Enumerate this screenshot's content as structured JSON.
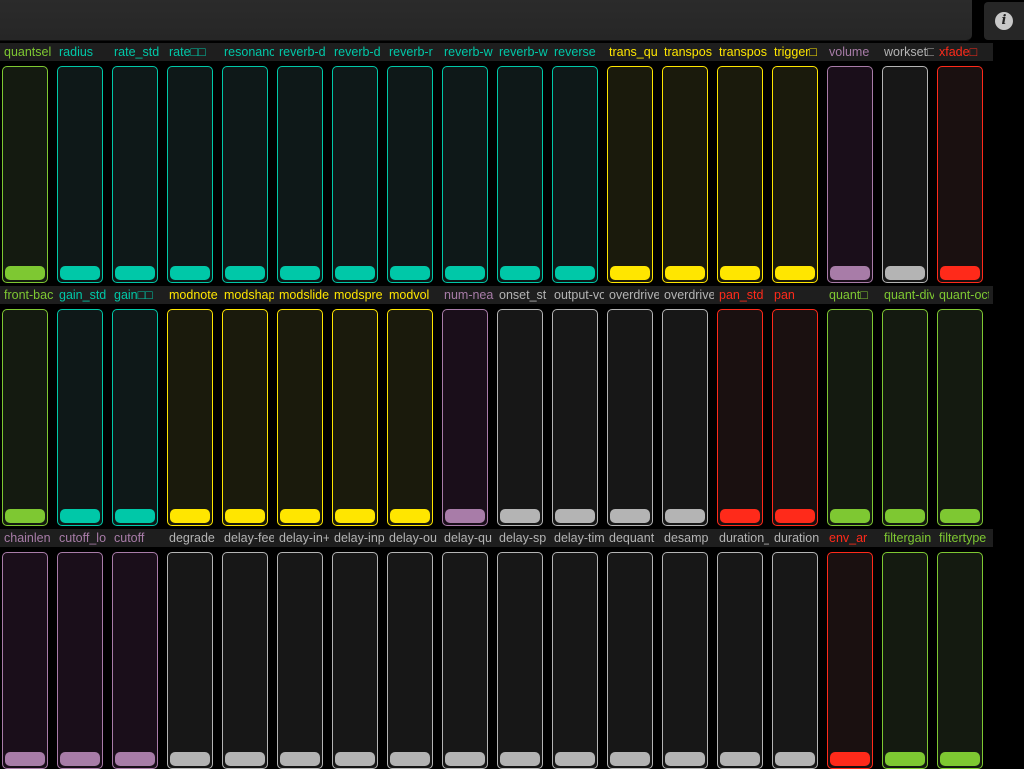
{
  "colors": {
    "green": "#7ec832",
    "teal": "#00c8a8",
    "yellow": "#ffe600",
    "purple": "#a87ca8",
    "gray": "#b4b4b4",
    "red": "#ff2a1a"
  },
  "info_icon": "info-icon",
  "rows": [
    {
      "sliders": [
        {
          "label": "quantsel",
          "color": "green",
          "value": 0
        },
        {
          "label": "radius",
          "color": "teal",
          "value": 0
        },
        {
          "label": "rate_std",
          "color": "teal",
          "value": 0
        },
        {
          "label": "rate□□",
          "color": "teal",
          "value": 0
        },
        {
          "label": "resonance",
          "color": "teal",
          "value": 0
        },
        {
          "label": "reverb-d",
          "color": "teal",
          "value": 0
        },
        {
          "label": "reverb-d",
          "color": "teal",
          "value": 0
        },
        {
          "label": "reverb-r",
          "color": "teal",
          "value": 0
        },
        {
          "label": "reverb-w",
          "color": "teal",
          "value": 0
        },
        {
          "label": "reverb-w",
          "color": "teal",
          "value": 0
        },
        {
          "label": "reverse",
          "color": "teal",
          "value": 0
        },
        {
          "label": "trans_qu",
          "color": "yellow",
          "value": 0
        },
        {
          "label": "transpos",
          "color": "yellow",
          "value": 0
        },
        {
          "label": "transpos",
          "color": "yellow",
          "value": 0
        },
        {
          "label": "trigger□",
          "color": "yellow",
          "value": 0
        },
        {
          "label": "volume",
          "color": "purple",
          "value": 0
        },
        {
          "label": "workset□",
          "color": "gray",
          "value": 0
        },
        {
          "label": "xfade□",
          "color": "red",
          "value": 0
        }
      ]
    },
    {
      "sliders": [
        {
          "label": "front-bac",
          "color": "green",
          "value": 0
        },
        {
          "label": "gain_std",
          "color": "teal",
          "value": 0
        },
        {
          "label": "gain□□",
          "color": "teal",
          "value": 0
        },
        {
          "label": "modnote",
          "color": "yellow",
          "value": 0
        },
        {
          "label": "modshap",
          "color": "yellow",
          "value": 0
        },
        {
          "label": "modslide",
          "color": "yellow",
          "value": 0
        },
        {
          "label": "modspre",
          "color": "yellow",
          "value": 0
        },
        {
          "label": "modvol",
          "color": "yellow",
          "value": 0
        },
        {
          "label": "num-nea",
          "color": "purple",
          "value": 0
        },
        {
          "label": "onset_st",
          "color": "gray",
          "value": 0
        },
        {
          "label": "output-vo",
          "color": "gray",
          "value": 0
        },
        {
          "label": "overdrive",
          "color": "gray",
          "value": 0
        },
        {
          "label": "overdrive",
          "color": "gray",
          "value": 0
        },
        {
          "label": "pan_std",
          "color": "red",
          "value": 0
        },
        {
          "label": "pan",
          "color": "red",
          "value": 0
        },
        {
          "label": "quant□",
          "color": "green",
          "value": 0
        },
        {
          "label": "quant-div",
          "color": "green",
          "value": 0
        },
        {
          "label": "quant-oct",
          "color": "green",
          "value": 0
        }
      ]
    },
    {
      "sliders": [
        {
          "label": "chainlen",
          "color": "purple",
          "value": 0
        },
        {
          "label": "cutoff_lo",
          "color": "purple",
          "value": 0
        },
        {
          "label": "cutoff",
          "color": "purple",
          "value": 0
        },
        {
          "label": "degrade",
          "color": "gray",
          "value": 0
        },
        {
          "label": "delay-fee",
          "color": "gray",
          "value": 0
        },
        {
          "label": "delay-in+",
          "color": "gray",
          "value": 0
        },
        {
          "label": "delay-inp",
          "color": "gray",
          "value": 0
        },
        {
          "label": "delay-ou",
          "color": "gray",
          "value": 0
        },
        {
          "label": "delay-qu",
          "color": "gray",
          "value": 0
        },
        {
          "label": "delay-sp",
          "color": "gray",
          "value": 0
        },
        {
          "label": "delay-tim",
          "color": "gray",
          "value": 0
        },
        {
          "label": "dequant",
          "color": "gray",
          "value": 0
        },
        {
          "label": "desamp",
          "color": "gray",
          "value": 0
        },
        {
          "label": "duration_",
          "color": "gray",
          "value": 0
        },
        {
          "label": "duration",
          "color": "gray",
          "value": 0
        },
        {
          "label": "env_ar",
          "color": "red",
          "value": 0
        },
        {
          "label": "filtergain",
          "color": "green",
          "value": 0
        },
        {
          "label": "filtertype",
          "color": "green",
          "value": 0
        }
      ]
    }
  ]
}
